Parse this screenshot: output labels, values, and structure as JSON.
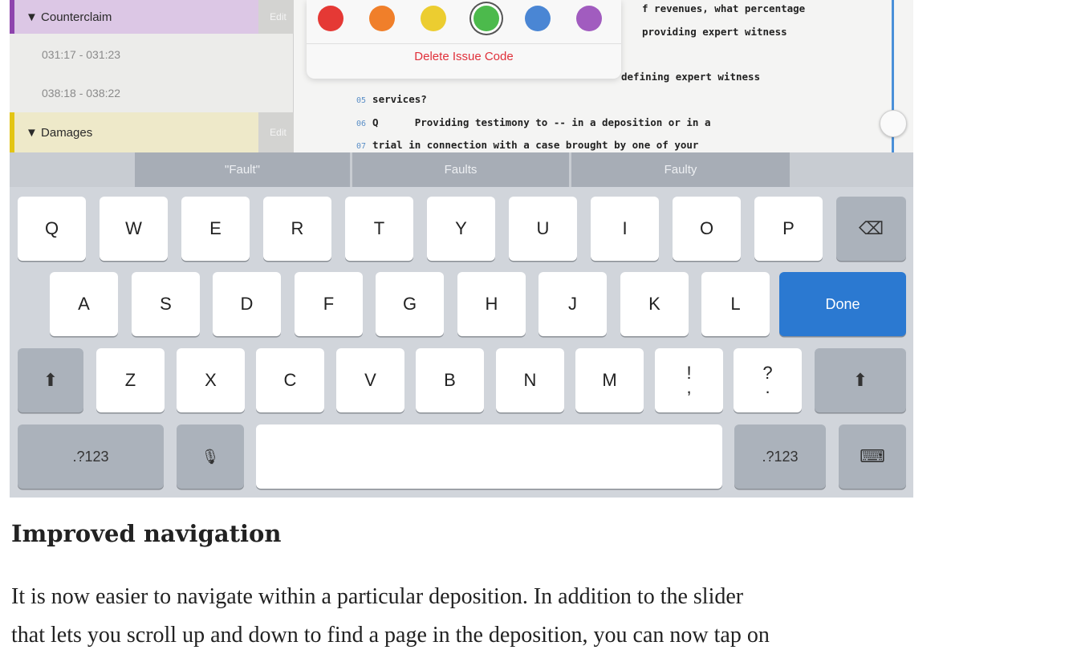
{
  "sidebar": {
    "issues": [
      {
        "label": "▼ Counterclaim",
        "edit": "Edit"
      },
      {
        "label": "▼ Damages",
        "edit": "Edit"
      }
    ],
    "ranges": [
      "031:17 - 031:23",
      "038:18 - 038:22"
    ]
  },
  "transcript": {
    "lines": [
      {
        "num": "",
        "text": "f revenues, what percentage"
      },
      {
        "num": "",
        "text": "providing expert witness"
      },
      {
        "num": "",
        "text": "defining expert witness"
      },
      {
        "num": "05",
        "text": "services?"
      },
      {
        "num": "06",
        "text": "Q      Providing testimony to -- in a deposition or in a"
      },
      {
        "num": "07",
        "text": "trial in connection with a case brought by one of your"
      }
    ]
  },
  "popover": {
    "colors": [
      "#e53935",
      "#f07f2a",
      "#eccd30",
      "#4cba4c",
      "#4a86d4",
      "#a15cbf"
    ],
    "selected_index": 3,
    "delete_label": "Delete Issue Code"
  },
  "suggestions": [
    "\"Fault\"",
    "Faults",
    "Faulty"
  ],
  "keyboard": {
    "row1": [
      "Q",
      "W",
      "E",
      "R",
      "T",
      "Y",
      "U",
      "I",
      "O",
      "P"
    ],
    "row2": [
      "A",
      "S",
      "D",
      "F",
      "G",
      "H",
      "J",
      "K",
      "L"
    ],
    "row3": [
      "Z",
      "X",
      "C",
      "V",
      "B",
      "N",
      "M"
    ],
    "punct1": {
      "top": "!",
      "bottom": ","
    },
    "punct2": {
      "top": "?",
      "bottom": "."
    },
    "done_label": "Done",
    "numbers_label": ".?123",
    "backspace_glyph": "⌫",
    "shift_glyph": "⬆",
    "mic_glyph": "🎙",
    "hide_keyboard_glyph": "⌨"
  },
  "article": {
    "heading": "Improved navigation",
    "para_line1": "It is now easier to navigate within a particular deposition.  In addition to the slider",
    "para_line2": "that lets you scroll up and down to find a page in the deposition, you can now tap on"
  }
}
